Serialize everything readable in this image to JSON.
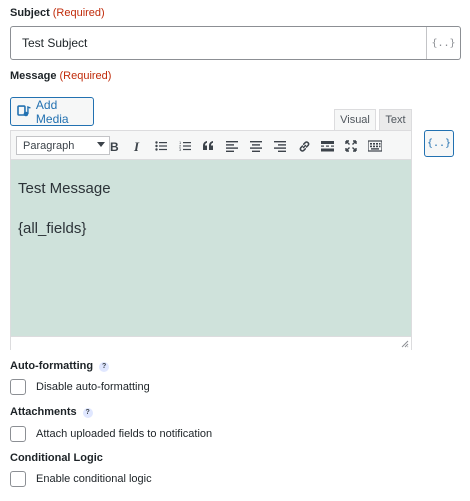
{
  "subject": {
    "label": "Subject",
    "required": "(Required)",
    "value": "Test Subject",
    "merge_icon_text": "{..}"
  },
  "message": {
    "label": "Message",
    "required": "(Required)",
    "add_media_label": "Add Media",
    "tabs": {
      "visual": "Visual",
      "text": "Text"
    },
    "merge_icon_text": "{..}",
    "toolbar": {
      "format_value": "Paragraph",
      "buttons": [
        "bold-icon",
        "italic-icon",
        "bullet-list-icon",
        "numbered-list-icon",
        "blockquote-icon",
        "align-left-icon",
        "align-center-icon",
        "align-right-icon",
        "link-icon",
        "read-more-icon",
        "fullscreen-icon",
        "toolbar-toggle-icon"
      ]
    },
    "content": [
      "Test Message",
      "{all_fields}"
    ]
  },
  "auto_formatting": {
    "label": "Auto-formatting",
    "help": "?",
    "checkbox_label": "Disable auto-formatting"
  },
  "attachments": {
    "label": "Attachments",
    "help": "?",
    "checkbox_label": "Attach uploaded fields to notification"
  },
  "conditional_logic": {
    "label": "Conditional Logic",
    "checkbox_label": "Enable conditional logic"
  },
  "colors": {
    "accent": "#2271b1",
    "required": "#c02b0a",
    "editor_bg": "#cfe2db"
  }
}
